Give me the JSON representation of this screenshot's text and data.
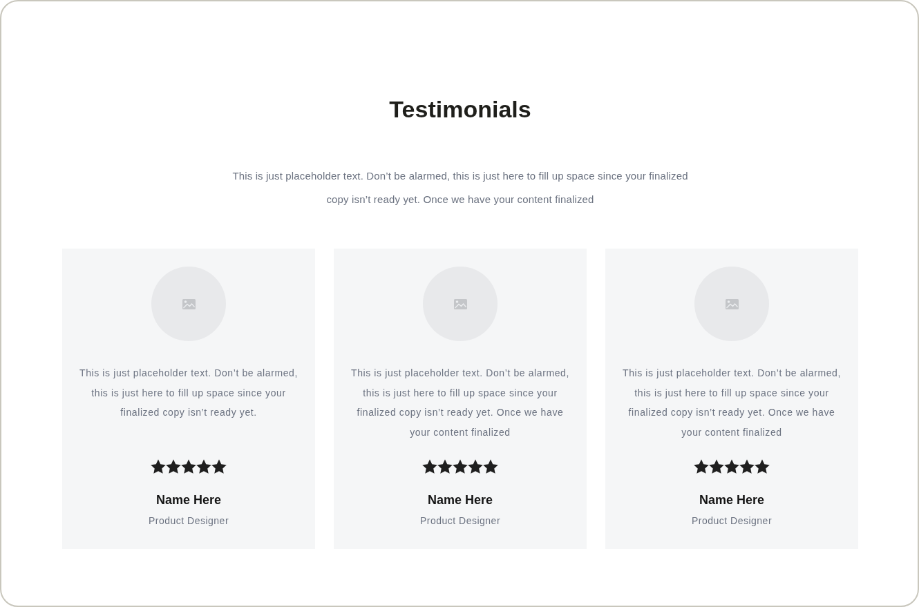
{
  "section": {
    "title": "Testimonials",
    "intro": "This is just placeholder text. Don’t be alarmed, this is just here to fill up space since your finalized copy isn’t ready yet. Once we have your content finalized"
  },
  "testimonials": [
    {
      "quote": "This is just placeholder text. Don’t be alarmed, this is just here to fill up space since your finalized copy isn’t ready yet.",
      "stars": 5,
      "name": "Name Here",
      "role": "Product Designer"
    },
    {
      "quote": "This is just placeholder text. Don’t be alarmed, this is just here to fill up space since your finalized copy isn’t ready yet. Once we have your content finalized",
      "stars": 5,
      "name": "Name Here",
      "role": "Product Designer"
    },
    {
      "quote": "This is just placeholder text. Don’t be alarmed, this is just here to fill up space since your finalized copy isn’t ready yet. Once we have your content finalized",
      "stars": 5,
      "name": "Name Here",
      "role": "Product Designer"
    }
  ]
}
